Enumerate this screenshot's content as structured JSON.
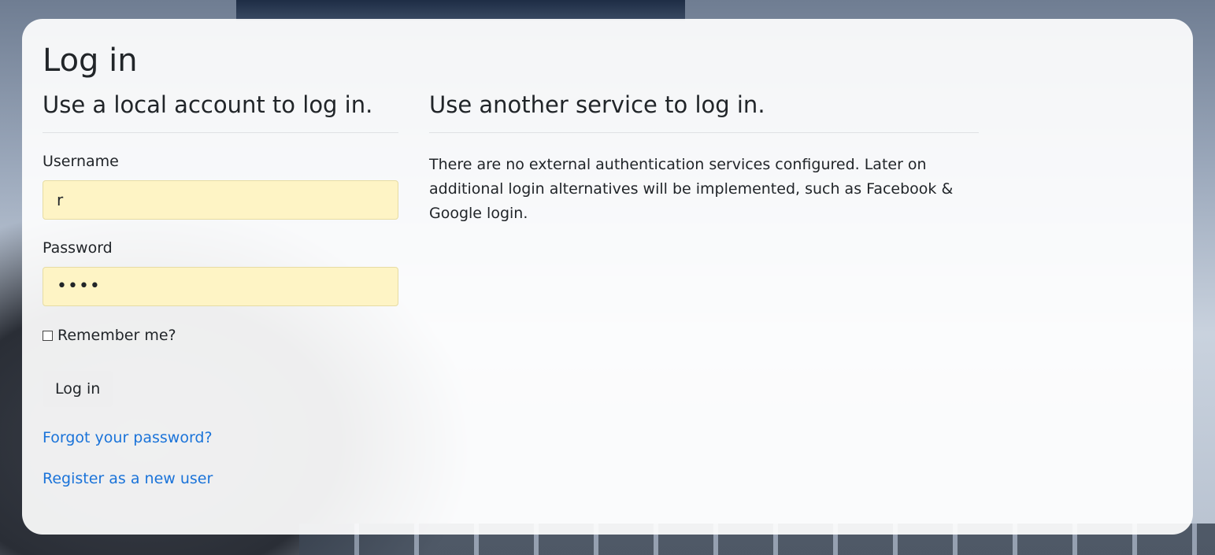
{
  "page": {
    "title": "Log in"
  },
  "local_login": {
    "heading": "Use a local account to log in.",
    "username_label": "Username",
    "username_value": "r",
    "password_label": "Password",
    "password_value": "••••",
    "remember_label": "Remember me?",
    "remember_checked": false,
    "submit_label": "Log in",
    "forgot_link": "Forgot your password?",
    "register_link": "Register as a new user"
  },
  "external_login": {
    "heading": "Use another service to log in.",
    "message": "There are no external authentication services configured. Later on additional login alternatives will be implemented, such as Facebook & Google login."
  },
  "colors": {
    "link": "#1a73d9",
    "autofill_bg": "#fef4c5",
    "button_bg": "#eeeeef"
  }
}
